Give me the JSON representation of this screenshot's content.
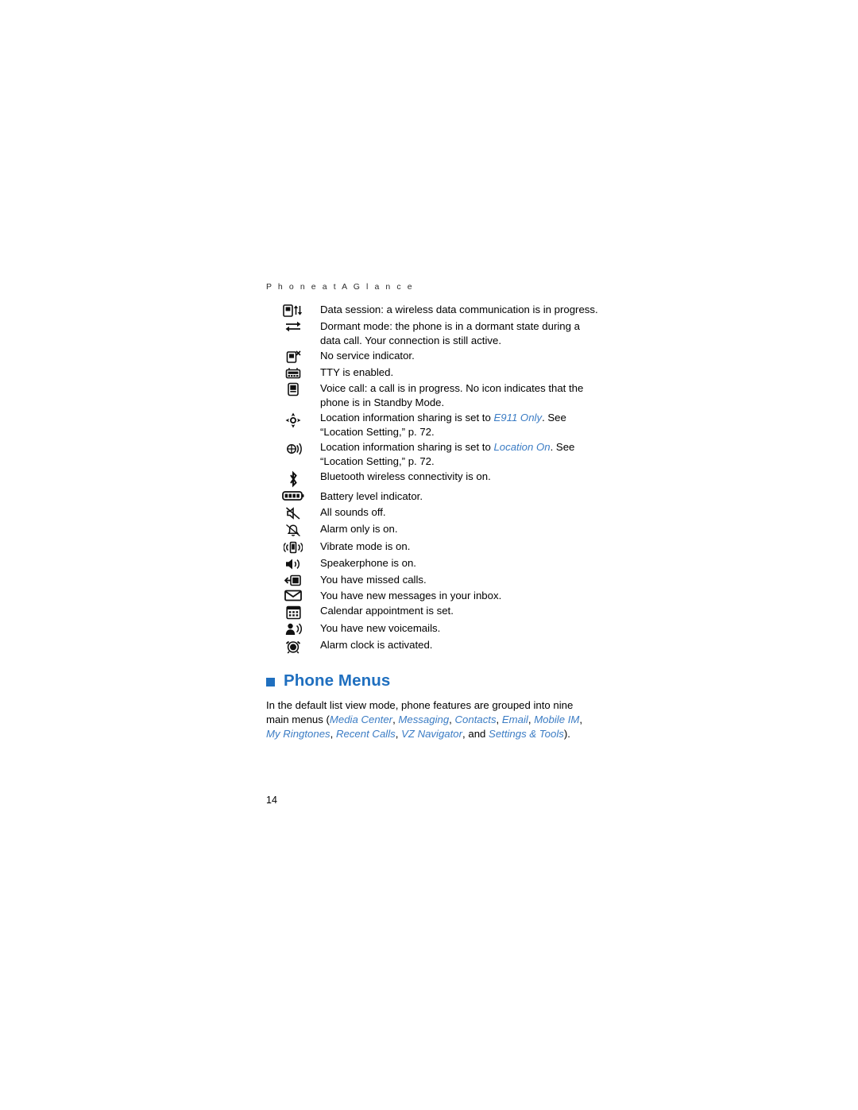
{
  "page": {
    "running_head": "P h o n e   a t   A   G l a n c e",
    "folio": "14"
  },
  "icon_list": [
    {
      "icon": "data-session-icon",
      "text_parts": [
        {
          "t": "Data session: a wireless data communication is in progress.",
          "style": "normal"
        }
      ]
    },
    {
      "icon": "dormant-mode-icon",
      "text_parts": [
        {
          "t": "Dormant mode: the phone is in a dormant state during a data call. Your connection is still active.",
          "style": "normal"
        }
      ]
    },
    {
      "icon": "no-service-icon",
      "text_parts": [
        {
          "t": "No service indicator.",
          "style": "normal"
        }
      ]
    },
    {
      "icon": "tty-icon",
      "text_parts": [
        {
          "t": "TTY is enabled.",
          "style": "normal"
        }
      ]
    },
    {
      "icon": "voice-call-icon",
      "text_parts": [
        {
          "t": "Voice call: a call is in progress. No icon indicates that the phone is in Standby Mode.",
          "style": "normal"
        }
      ]
    },
    {
      "icon": "location-e911-icon",
      "text_parts": [
        {
          "t": "Location information sharing is set to ",
          "style": "normal"
        },
        {
          "t": "E911 Only",
          "style": "em"
        },
        {
          "t": ". See “Location Setting,” p. 72.",
          "style": "normal"
        }
      ]
    },
    {
      "icon": "location-on-icon",
      "text_parts": [
        {
          "t": "Location information sharing is set to ",
          "style": "normal"
        },
        {
          "t": "Location On",
          "style": "em"
        },
        {
          "t": ". See “Location Setting,” p. 72.",
          "style": "normal"
        }
      ]
    },
    {
      "icon": "bluetooth-icon",
      "text_parts": [
        {
          "t": "Bluetooth wireless connectivity is on.",
          "style": "normal"
        }
      ]
    },
    {
      "icon": "battery-level-icon",
      "text_parts": [
        {
          "t": "Battery level indicator.",
          "style": "normal"
        }
      ]
    },
    {
      "icon": "all-sounds-off-icon",
      "text_parts": [
        {
          "t": "All sounds off.",
          "style": "normal"
        }
      ]
    },
    {
      "icon": "alarm-only-icon",
      "text_parts": [
        {
          "t": "Alarm only is on.",
          "style": "normal"
        }
      ]
    },
    {
      "icon": "vibrate-mode-icon",
      "text_parts": [
        {
          "t": "Vibrate mode is on.",
          "style": "normal"
        }
      ]
    },
    {
      "icon": "speakerphone-icon",
      "text_parts": [
        {
          "t": "Speakerphone is on.",
          "style": "normal"
        }
      ]
    },
    {
      "icon": "missed-calls-icon",
      "text_parts": [
        {
          "t": "You have missed calls.",
          "style": "normal"
        }
      ]
    },
    {
      "icon": "new-message-icon",
      "text_parts": [
        {
          "t": "You have new messages in your inbox.",
          "style": "normal"
        }
      ]
    },
    {
      "icon": "calendar-icon",
      "text_parts": [
        {
          "t": "Calendar appointment is set.",
          "style": "normal"
        }
      ]
    },
    {
      "icon": "voicemail-icon",
      "text_parts": [
        {
          "t": "You have new voicemails.",
          "style": "normal"
        }
      ]
    },
    {
      "icon": "alarm-clock-icon",
      "text_parts": [
        {
          "t": "Alarm clock is activated.",
          "style": "normal"
        }
      ]
    }
  ],
  "section": {
    "heading": "Phone Menus",
    "paragraph_parts": [
      {
        "t": "In the default list view mode, phone features are grouped into nine main menus (",
        "style": "normal"
      },
      {
        "t": "Media Center",
        "style": "menu"
      },
      {
        "t": ", ",
        "style": "normal"
      },
      {
        "t": "Messaging",
        "style": "menu"
      },
      {
        "t": ", ",
        "style": "normal"
      },
      {
        "t": "Contacts",
        "style": "menu"
      },
      {
        "t": ", ",
        "style": "normal"
      },
      {
        "t": "Email",
        "style": "menu"
      },
      {
        "t": ", ",
        "style": "normal"
      },
      {
        "t": "Mobile IM",
        "style": "menu"
      },
      {
        "t": ", ",
        "style": "normal"
      },
      {
        "t": "My Ringtones",
        "style": "menu"
      },
      {
        "t": ", ",
        "style": "normal"
      },
      {
        "t": "Recent Calls",
        "style": "menu"
      },
      {
        "t": ", ",
        "style": "normal"
      },
      {
        "t": "VZ Navigator",
        "style": "menu"
      },
      {
        "t": ", and ",
        "style": "normal"
      },
      {
        "t": "Settings & Tools",
        "style": "menu"
      },
      {
        "t": ").",
        "style": "normal"
      }
    ]
  },
  "colors": {
    "accent": "#1f6fbf",
    "italic_blue": "#3b7cc4",
    "text": "#000000"
  }
}
